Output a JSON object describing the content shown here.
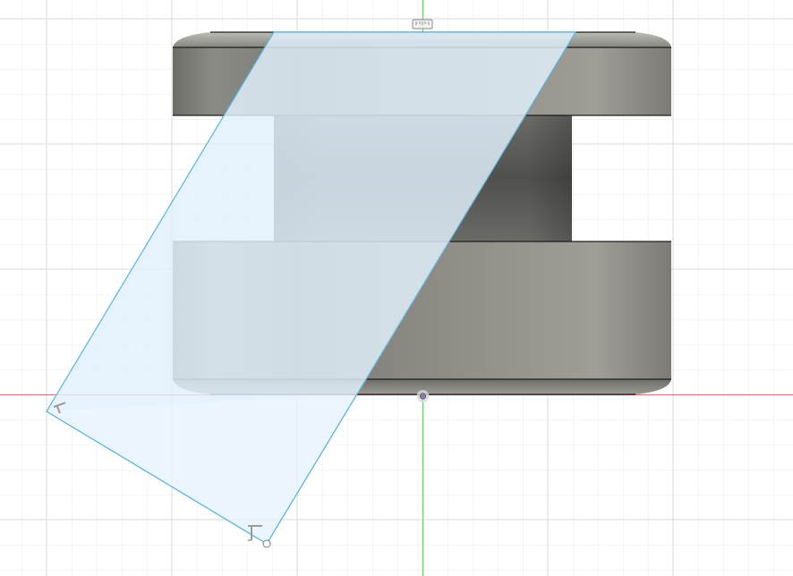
{
  "viewport": {
    "background": "#ffffff",
    "grid_minor_color": "#ebebeb",
    "grid_major_color": "#d9d9d9",
    "x_axis_color": "#e05a5a",
    "y_axis_color": "#5ec25e"
  },
  "model": {
    "body_color": "#8a8a85",
    "edge_color": "#1c1c1c"
  },
  "sketch_plane": {
    "fill": "#eaf4fc",
    "stroke": "#5bb4da"
  },
  "icons": {
    "top_marker": "ruler-icon",
    "origin": "origin-point-icon",
    "plane_corner_1": "corner-handle-icon",
    "plane_corner_2": "corner-handle-icon",
    "plane_rotate": "rotate-handle-icon"
  }
}
